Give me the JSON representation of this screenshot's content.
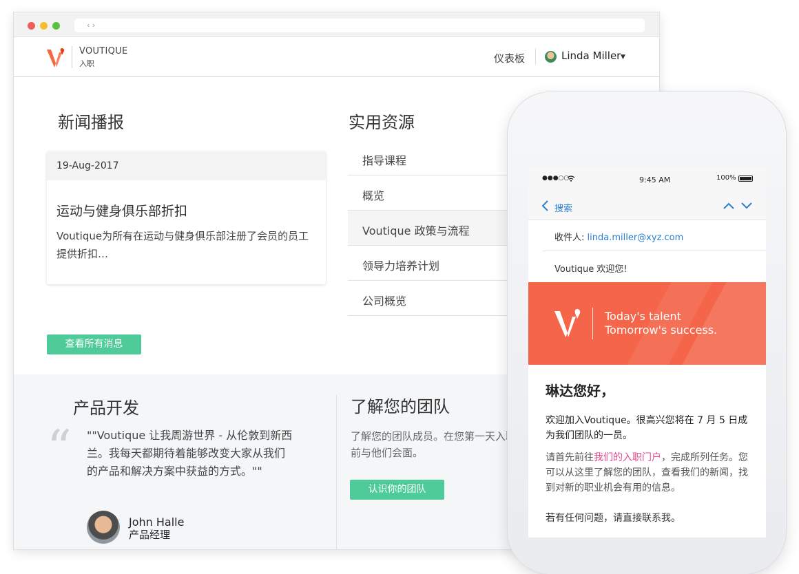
{
  "browser": {
    "url_nav": "‹ ›"
  },
  "header": {
    "brand_name": "VOUTIQUE",
    "brand_sub": "入职",
    "nav_dashboard": "仪表板",
    "user_name": "Linda Miller",
    "user_caret": "▼"
  },
  "news": {
    "title": "新闻播报",
    "date": "19-Aug-2017",
    "headline": "运动与健身俱乐部折扣",
    "body": "Voutique为所有在运动与健身俱乐部注册了会员的员工提供折扣…",
    "view_all": "查看所有消息"
  },
  "resources": {
    "title": "实用资源",
    "items": [
      {
        "label": "指导课程"
      },
      {
        "label": "概览"
      },
      {
        "label": "Voutique 政策与流程"
      },
      {
        "label": "领导力培养计划"
      },
      {
        "label": "公司概览"
      }
    ]
  },
  "product": {
    "title": "产品开发",
    "quote": "\"\"Voutique 让我周游世界 - 从伦敦到新西兰。我每天都期待着能够改变大家从我们的产品和解决方案中获益的方式。\"\"",
    "person_name": "John Halle",
    "person_role": "产品经理"
  },
  "team": {
    "title": "了解您的团队",
    "desc": "了解您的团队成员。在您第一天入职前与他们会面。",
    "button": "认识你的团队"
  },
  "phone": {
    "signal": "●●●○○",
    "time": "9:45 AM",
    "battery": "100%",
    "back_label": "搜索",
    "to_label": "收件人:",
    "to_email": "linda.miller@xyz.com",
    "subject": "Voutique 欢迎您!",
    "banner_line1": "Today's talent",
    "banner_line2": "Tomorrow's success.",
    "greeting": "琳达您好，",
    "para1": "欢迎加入Voutique。很高兴您将在 7 月 5 日成为我们团队的一员。",
    "para2_a": "请首先前往",
    "para2_link": "我们的入职门户",
    "para2_b": "，完成所列任务。您可以从这里了解您的团队，查看我们的新闻，找到对新的职业机会有用的信息。",
    "para3": "若有任何问题，请直接联系我。"
  },
  "colors": {
    "accent_green": "#4ecb99",
    "brand_orange": "#f4654a",
    "link_blue": "#2b7fd1",
    "link_pink": "#e54b8a"
  }
}
